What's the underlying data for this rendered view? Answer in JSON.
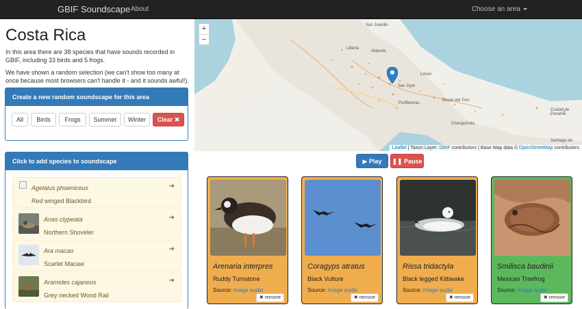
{
  "navbar": {
    "brand": "GBIF Soundscape",
    "about": "About",
    "choose_area": "Choose an area"
  },
  "area": {
    "title": "Costa Rica",
    "intro": "In this area there are 38 species that have sounds recorded in GBIF, including 33 birds and 5 frogs.",
    "note": "We have shown a random selection (we can't show too many at once because most browsers can't handle it - and it sounds awful!)."
  },
  "filters": {
    "heading": "Create a new random soundscape for this area",
    "buttons": [
      "All",
      "Birds",
      "Frogs",
      "Summer",
      "Winter"
    ],
    "clear": "Clear ✖"
  },
  "species_panel": {
    "heading": "Click to add species to soundscape",
    "items": [
      {
        "latin": "Agelaius phoeniceus",
        "common": "Red winged Blackbird"
      },
      {
        "latin": "Anas clypeata",
        "common": "Northern Shoveler"
      },
      {
        "latin": "Ara macao",
        "common": "Scarlet Macaw"
      },
      {
        "latin": "Aramides cajaneus",
        "common": "Grey necked Wood Rail"
      }
    ]
  },
  "map": {
    "zoom_in": "+",
    "zoom_out": "−",
    "labels": [
      "San Juanillo",
      "Liberia",
      "Alajuela",
      "San José",
      "Puntarenas",
      "Limón",
      "Bocas del Toro",
      "Changuinola",
      "Ciudad de Panamá",
      "Santiago de"
    ],
    "attribution": {
      "leaflet": "Leaflet",
      "taxon_layer": " | Taxon Layer: ",
      "gbif": "GBIF",
      "contributors": " contributors | Base Map data © ",
      "osm": "OpenStreetMap",
      "osm_suffix": " contributors"
    }
  },
  "controls": {
    "play": "▶ Play",
    "pause": "❚❚ Pause"
  },
  "cards": [
    {
      "latin": "Arenaria interpres",
      "common": "Ruddy Turnstone",
      "source_label": "Source: ",
      "source_link": "image audio",
      "remove": "✖ remove",
      "color": "#f0ad4e"
    },
    {
      "latin": "Coragyps atratus",
      "common": "Black Vulture",
      "source_label": "Source: ",
      "source_link": "image audio",
      "remove": "✖ remove",
      "color": "#f0ad4e"
    },
    {
      "latin": "Rissa tridactyla",
      "common": "Black legged Kittiwake",
      "source_label": "Source: ",
      "source_link": "image audio",
      "remove": "✖ remove",
      "color": "#f0ad4e"
    },
    {
      "latin": "Smilisca baudinii",
      "common": "Mexican Treefrog",
      "source_label": "Source: ",
      "source_link": "image audio",
      "remove": "✖ remove",
      "color": "#5cb85c"
    }
  ]
}
